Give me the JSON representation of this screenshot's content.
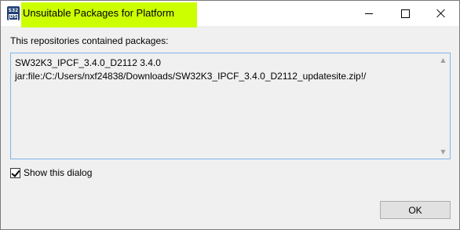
{
  "window": {
    "title": "Unsuitable Packages for Platform",
    "icon": "s32ds-app-icon",
    "icon_text_line1": "S32",
    "icon_text_line2": "DS",
    "highlight_color": "#ccff00"
  },
  "controls": {
    "minimize": "minimize-icon",
    "maximize": "maximize-icon",
    "close": "close-icon"
  },
  "body": {
    "label": "This repositories contained packages:",
    "lines": [
      "SW32K3_IPCF_3.4.0_D2112 3.4.0",
      "jar:file:/C:/Users/nxf24838/Downloads/SW32K3_IPCF_3.4.0_D2112_updatesite.zip!/"
    ],
    "border_color": "#7eb4ea"
  },
  "checkbox": {
    "label": "Show this dialog",
    "checked": true
  },
  "buttons": {
    "ok_label": "OK"
  }
}
